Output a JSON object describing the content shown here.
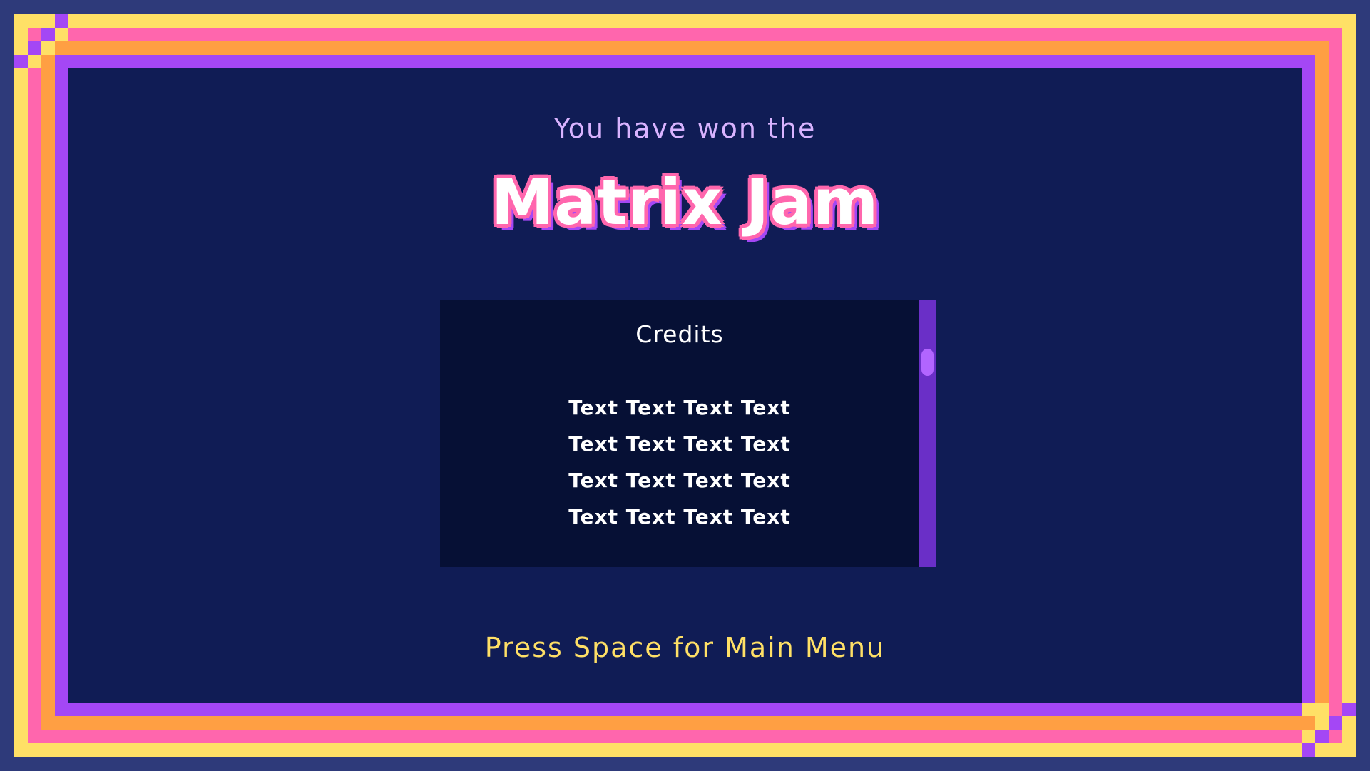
{
  "screen": {
    "subtitle": "You have won the",
    "title": "Matrix Jam"
  },
  "credits": {
    "heading": "Credits",
    "lines": [
      "Text Text Text Text",
      "Text Text Text Text",
      "Text Text Text Text",
      "Text Text Text Text"
    ],
    "scroll_position": 0.15
  },
  "prompt": {
    "label": "Press Space for Main Menu"
  },
  "colors": {
    "background": "#101c55",
    "frame_outer": "#2e3a7a",
    "frame_yellow": "#ffe066",
    "frame_pink": "#ff66ad",
    "frame_orange": "#ff9f43",
    "frame_purple": "#a447f5",
    "panel": "#061035",
    "scrollbar": "#6a2fc7",
    "scroll_thumb": "#b265ff",
    "subtitle_text": "#d9b3ff",
    "prompt_text": "#ffe066"
  }
}
